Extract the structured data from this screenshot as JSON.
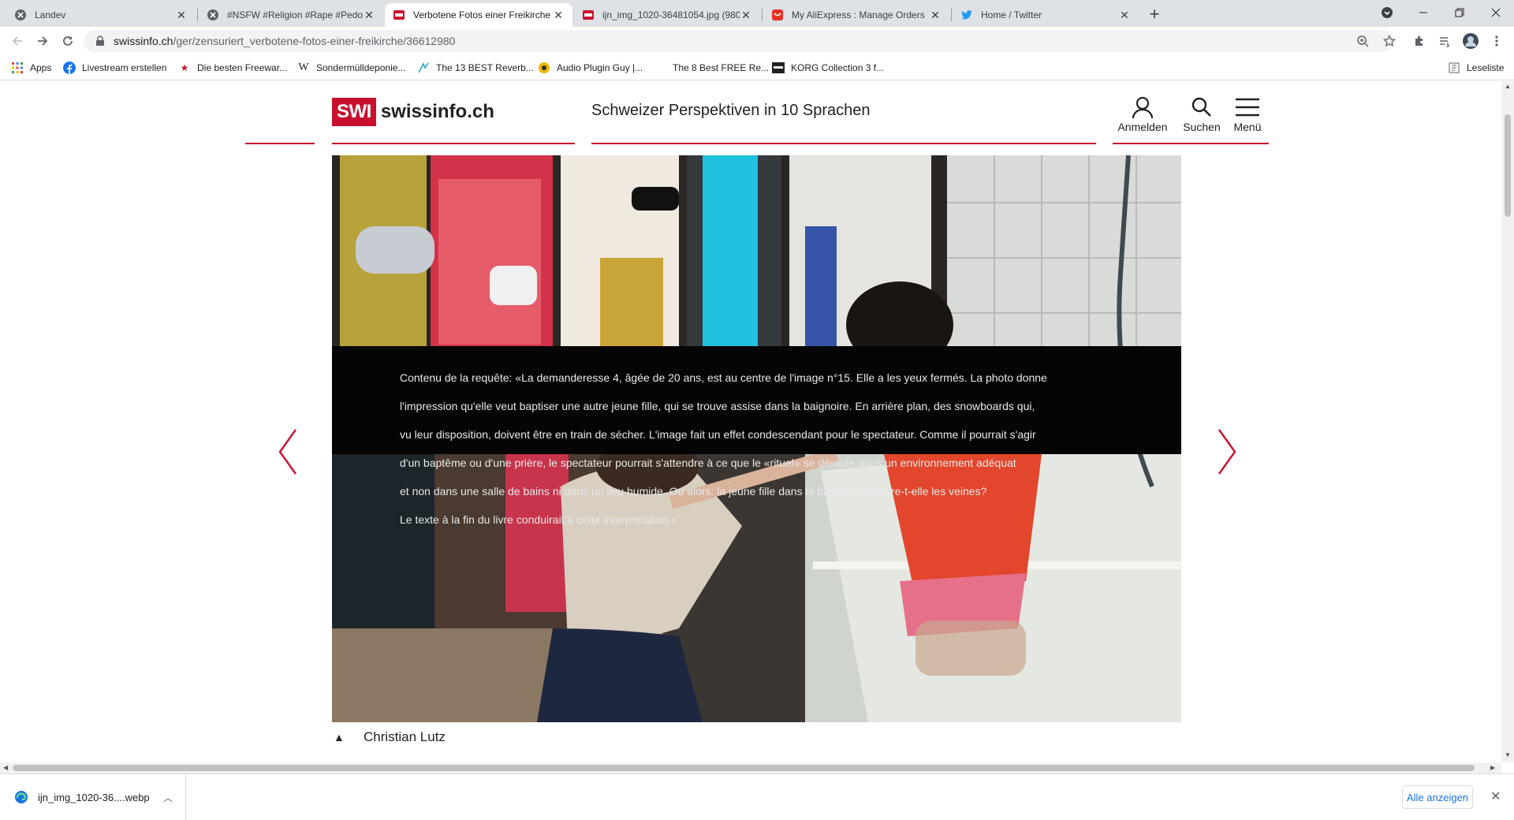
{
  "browser": {
    "tabs": [
      {
        "title": "Landev",
        "favicon": "globe-icon",
        "active": false
      },
      {
        "title": "#NSFW #Religion #Rape #Pedo #",
        "favicon": "globe-icon",
        "active": false
      },
      {
        "title": "Verbotene Fotos einer Freikirche",
        "favicon": "swi-icon",
        "active": true
      },
      {
        "title": "ijn_img_1020-36481054.jpg (980",
        "favicon": "swi-icon",
        "active": false
      },
      {
        "title": "My AliExpress : Manage Orders",
        "favicon": "aliexpress-icon",
        "active": false
      },
      {
        "title": "Home / Twitter",
        "favicon": "twitter-icon",
        "active": false
      }
    ],
    "url_host": "swissinfo.ch",
    "url_path": "/ger/zensuriert_verbotene-fotos-einer-freikirche/36612980",
    "bookmarks": [
      {
        "label": "Apps",
        "icon": "apps-grid-icon"
      },
      {
        "label": "Livestream erstellen",
        "icon": "facebook-icon"
      },
      {
        "label": "Die besten Freewar...",
        "icon": "star-icon"
      },
      {
        "label": "Sondermülldeponie...",
        "icon": "wikipedia-icon"
      },
      {
        "label": "The 13 BEST Reverb...",
        "icon": "music-icon"
      },
      {
        "label": "Audio Plugin Guy |...",
        "icon": "plugin-icon"
      },
      {
        "label": "The 8 Best FREE Re...",
        "icon": "moon-icon"
      },
      {
        "label": "KORG Collection 3 f...",
        "icon": "korg-icon"
      }
    ],
    "reading_list_label": "Leseliste"
  },
  "site": {
    "logo_badge": "SWI",
    "logo_text": "swissinfo.ch",
    "tagline": "Schweizer Perspektiven in 10 Sprachen",
    "login_label": "Anmelden",
    "search_label": "Suchen",
    "menu_label": "Menü",
    "brand_color": "#c8102e"
  },
  "article": {
    "caption_lines": [
      "Contenu de la requête: «La demanderesse 4, âgée de 20 ans, est au centre de l'image n°15. Elle a les yeux fermés. La photo donne",
      "l'impression qu'elle veut baptiser une autre jeune fille, qui se trouve assise dans la baignoire. En arrière plan, des snowboards qui,",
      "vu leur disposition, doivent être en train de sécher. L'image fait un effet condescendant pour le spectateur. Comme il pourrait s'agir",
      "d'un baptême ou d'une prière, le spectateur pourrait s'attendre à ce que le «rituel» se déroule dans un environnement adéquat",
      "et non dans une salle de bains ni dans un lieu humide. Ou alors: la jeune fille dans la baignoire s'ouvre-t-elle les veines?",
      "Le texte à la fin du livre conduirait à cette interprétation.»"
    ],
    "photo_credit": "Christian Lutz"
  },
  "downloads": {
    "file_name": "ijn_img_1020-36....webp",
    "show_all_label": "Alle anzeigen"
  }
}
